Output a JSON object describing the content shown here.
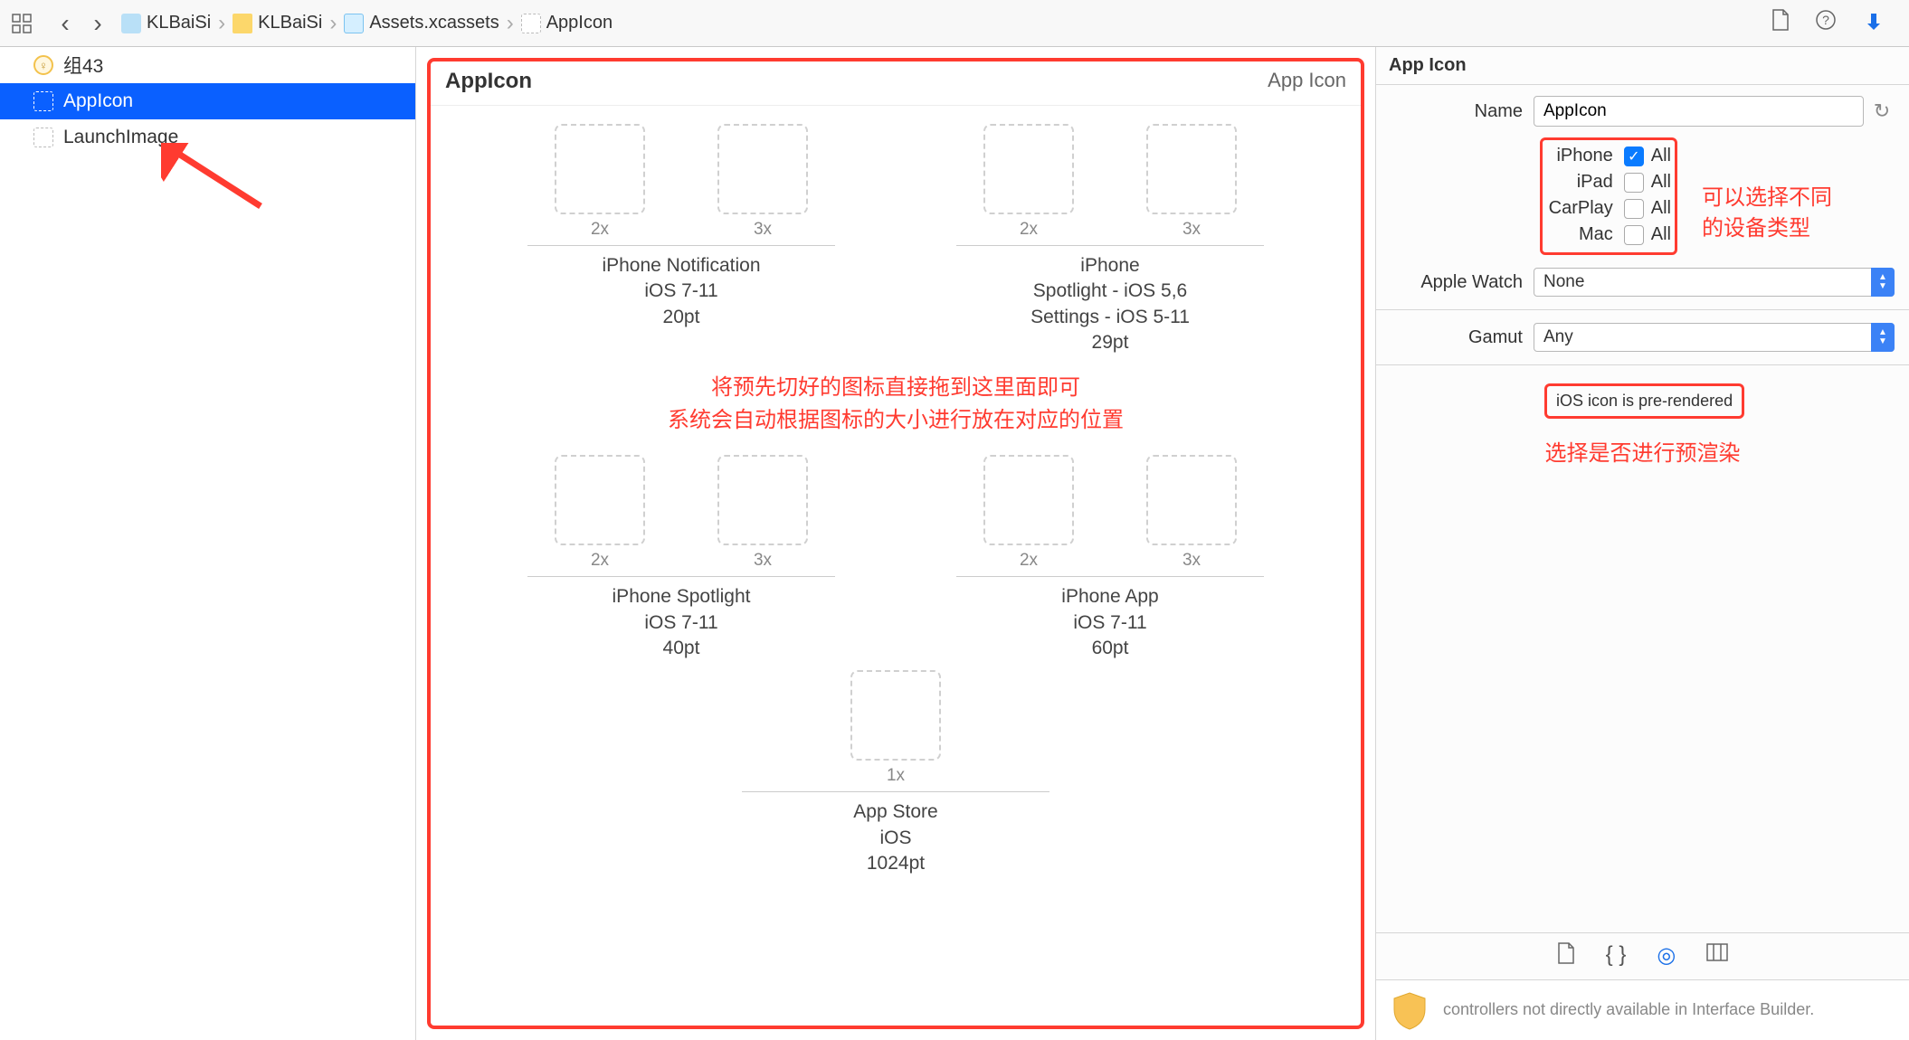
{
  "toolbar": {
    "breadcrumb": [
      {
        "label": "KLBaiSi",
        "iconClass": "bc-proj"
      },
      {
        "label": "KLBaiSi",
        "iconClass": "bc-folder"
      },
      {
        "label": "Assets.xcassets",
        "iconClass": "bc-assets"
      },
      {
        "label": "AppIcon",
        "iconClass": "bc-dashed"
      }
    ]
  },
  "sidebar": {
    "items": [
      {
        "label": "组43",
        "iconType": "badge"
      },
      {
        "label": "AppIcon",
        "iconType": "dashed",
        "selected": true
      },
      {
        "label": "LaunchImage",
        "iconType": "dashed"
      }
    ]
  },
  "canvas": {
    "title": "AppIcon",
    "type_label": "App Icon",
    "annotation": {
      "line1": "将预先切好的图标直接拖到这里面即可",
      "line2": "系统会自动根据图标的大小进行放在对应的位置"
    },
    "groups": [
      {
        "slots": [
          {
            "lbl": "2x"
          },
          {
            "lbl": "3x"
          }
        ],
        "caption": [
          "iPhone Notification",
          "iOS 7-11",
          "20pt"
        ]
      },
      {
        "slots": [
          {
            "lbl": "2x"
          },
          {
            "lbl": "3x"
          }
        ],
        "caption": [
          "iPhone",
          "Spotlight - iOS 5,6",
          "Settings - iOS 5-11",
          "29pt"
        ]
      },
      {
        "slots": [
          {
            "lbl": "2x"
          },
          {
            "lbl": "3x"
          }
        ],
        "caption": [
          "iPhone Spotlight",
          "iOS 7-11",
          "40pt"
        ]
      },
      {
        "slots": [
          {
            "lbl": "2x"
          },
          {
            "lbl": "3x"
          }
        ],
        "caption": [
          "iPhone App",
          "iOS 7-11",
          "60pt"
        ]
      }
    ],
    "single": {
      "slots": [
        {
          "lbl": "1x"
        }
      ],
      "caption": [
        "App Store",
        "iOS",
        "1024pt"
      ]
    }
  },
  "inspector": {
    "header": "App Icon",
    "name_label": "Name",
    "name_value": "AppIcon",
    "devices": [
      {
        "label": "iPhone",
        "value": "All",
        "checked": true
      },
      {
        "label": "iPad",
        "value": "All",
        "checked": false
      },
      {
        "label": "CarPlay",
        "value": "All",
        "checked": false
      },
      {
        "label": "Mac",
        "value": "All",
        "checked": false
      }
    ],
    "device_annotation": {
      "line1": "可以选择不同",
      "line2": "的设备类型"
    },
    "apple_watch_label": "Apple Watch",
    "apple_watch_value": "None",
    "gamut_label": "Gamut",
    "gamut_value": "Any",
    "prerender_label": "iOS icon is pre-rendered",
    "prerender_annotation": "选择是否进行预渲染",
    "footer_text": "controllers not directly available in Interface Builder."
  }
}
